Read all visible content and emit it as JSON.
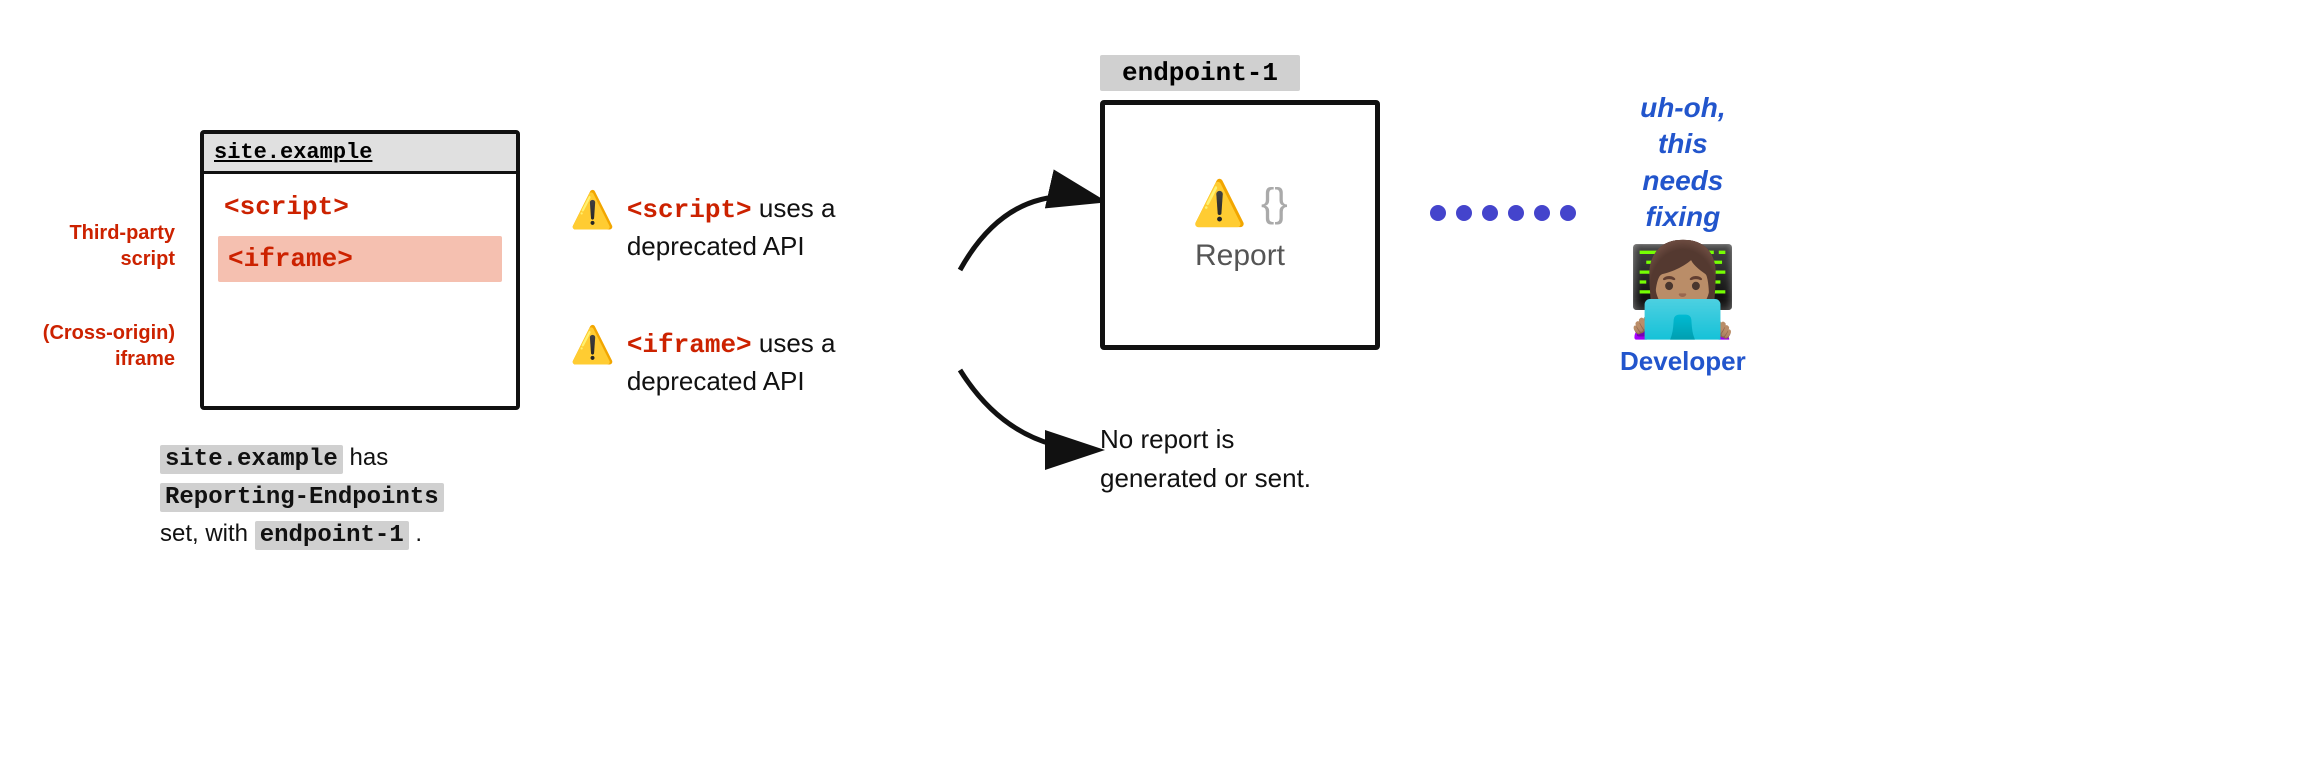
{
  "browser": {
    "title": "site.example",
    "script_tag": "<script>",
    "iframe_tag": "<iframe>"
  },
  "labels": {
    "third_party": "Third-party\nscript",
    "cross_origin": "(Cross-origin)\niframe"
  },
  "warnings": [
    {
      "icon": "⚠️",
      "text_prefix": "",
      "red_tag": "<script>",
      "text_suffix": " uses a\ndeprecated API"
    },
    {
      "icon": "⚠️",
      "text_prefix": "",
      "red_tag": "<iframe>",
      "text_suffix": " uses a\ndeprecated API"
    }
  ],
  "endpoint": {
    "label": "endpoint-1",
    "report_label": "Report"
  },
  "no_report_text": "No report is\ngenerated or sent.",
  "dots_count": 6,
  "developer": {
    "uh_oh": "uh-oh,\nthis\nneeds\nfixing",
    "label": "Developer"
  },
  "bottom_desc_line1": "site.example has",
  "bottom_desc_code1": "Reporting-Endpoints",
  "bottom_desc_line2": "set, with",
  "bottom_desc_code2": "endpoint-1",
  "bottom_desc_line3": "."
}
